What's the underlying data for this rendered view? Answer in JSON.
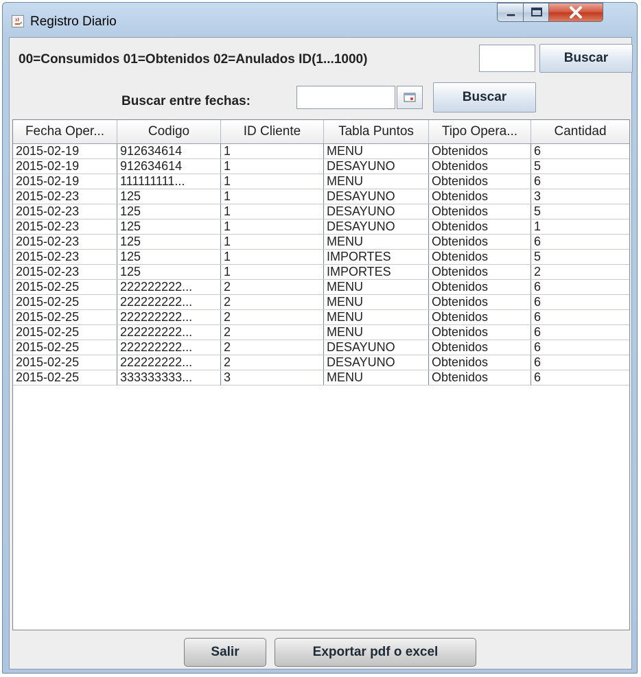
{
  "window": {
    "title": "Registro Diario"
  },
  "search": {
    "legend": "00=Consumidos  01=Obtenidos  02=Anulados  ID(1...1000)",
    "id_value": "",
    "buscar_label": "Buscar",
    "fechas_label": "Buscar entre fechas:",
    "date_value": "",
    "buscar_fechas_label": "Buscar"
  },
  "table": {
    "columns": [
      "Fecha Oper...",
      "Codigo",
      "ID Cliente",
      "Tabla Puntos",
      "Tipo Opera...",
      "Cantidad"
    ],
    "rows": [
      [
        "2015-02-19",
        "912634614",
        "1",
        "MENU",
        "Obtenidos",
        "6"
      ],
      [
        "2015-02-19",
        "912634614",
        "1",
        "DESAYUNO",
        "Obtenidos",
        "5"
      ],
      [
        "2015-02-19",
        "111111111...",
        "1",
        "MENU",
        "Obtenidos",
        "6"
      ],
      [
        "2015-02-23",
        "125",
        "1",
        "DESAYUNO",
        "Obtenidos",
        "3"
      ],
      [
        "2015-02-23",
        "125",
        "1",
        "DESAYUNO",
        "Obtenidos",
        "5"
      ],
      [
        "2015-02-23",
        "125",
        "1",
        "DESAYUNO",
        "Obtenidos",
        "1"
      ],
      [
        "2015-02-23",
        "125",
        "1",
        "MENU",
        "Obtenidos",
        "6"
      ],
      [
        "2015-02-23",
        "125",
        "1",
        "IMPORTES",
        "Obtenidos",
        "5"
      ],
      [
        "2015-02-23",
        "125",
        "1",
        "IMPORTES",
        "Obtenidos",
        "2"
      ],
      [
        "2015-02-25",
        "222222222...",
        "2",
        "MENU",
        "Obtenidos",
        "6"
      ],
      [
        "2015-02-25",
        "222222222...",
        "2",
        "MENU",
        "Obtenidos",
        "6"
      ],
      [
        "2015-02-25",
        "222222222...",
        "2",
        "MENU",
        "Obtenidos",
        "6"
      ],
      [
        "2015-02-25",
        "222222222...",
        "2",
        "MENU",
        "Obtenidos",
        "6"
      ],
      [
        "2015-02-25",
        "222222222...",
        "2",
        "DESAYUNO",
        "Obtenidos",
        "6"
      ],
      [
        "2015-02-25",
        "222222222...",
        "2",
        "DESAYUNO",
        "Obtenidos",
        "6"
      ],
      [
        "2015-02-25",
        "333333333...",
        "3",
        "MENU",
        "Obtenidos",
        "6"
      ]
    ]
  },
  "footer": {
    "salir_label": "Salir",
    "exportar_label": "Exportar pdf o excel"
  },
  "icons": {
    "app": "java-coffee-icon",
    "minimize": "minimize-icon",
    "maximize": "maximize-icon",
    "close": "close-icon",
    "calendar": "calendar-icon"
  },
  "colors": {
    "title_gradient": "#b6cde6",
    "close_button": "#c13a1f",
    "panel_background": "#eeeeee"
  }
}
